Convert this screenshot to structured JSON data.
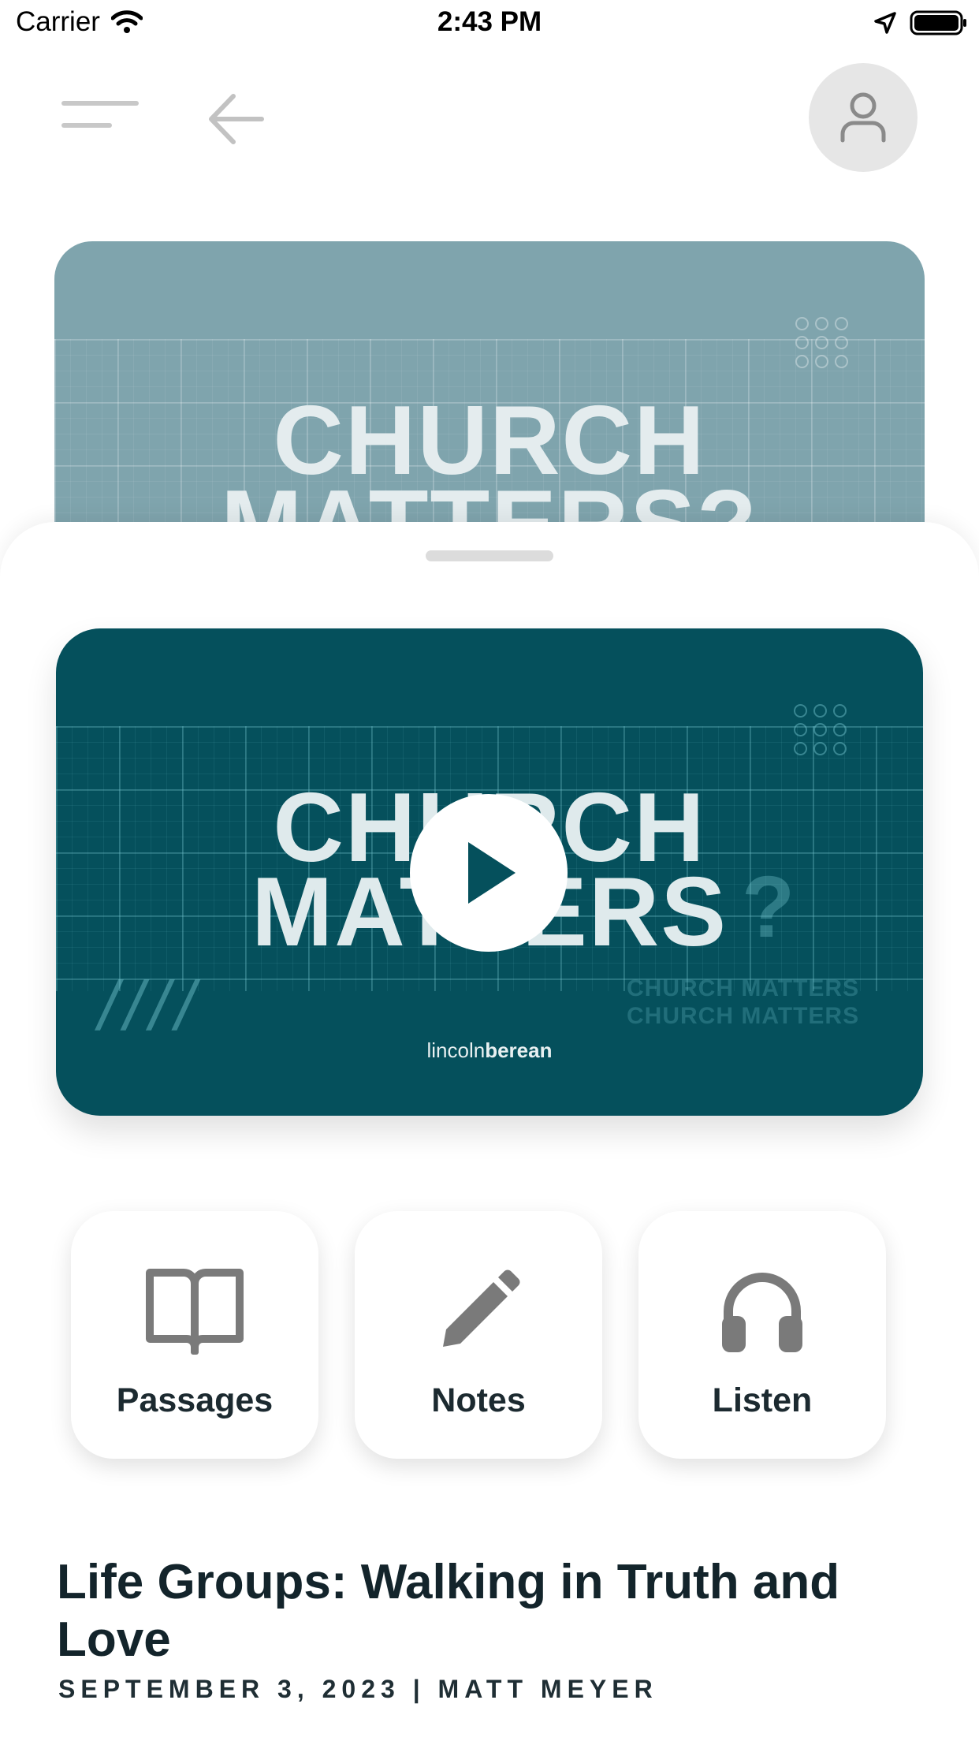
{
  "status_bar": {
    "carrier": "Carrier",
    "time": "2:43 PM"
  },
  "header": {
    "menu_icon": "menu-icon",
    "back_icon": "back-arrow-icon",
    "profile_icon": "person-icon"
  },
  "background_banner": {
    "title_line1": "CHURCH",
    "title_line2": "MATTERS?"
  },
  "video": {
    "title_line1": "CHURCH",
    "title_line2": "MATTERS",
    "question_mark": "?",
    "ghost_line1": "CHURCH MATTERS",
    "ghost_line2": "CHURCH MATTERS",
    "brand_light": "lincoln",
    "brand_bold": "berean",
    "play_icon": "play-icon"
  },
  "actions": [
    {
      "label": "Passages",
      "icon": "open-book-icon"
    },
    {
      "label": "Notes",
      "icon": "pencil-icon"
    },
    {
      "label": "Listen",
      "icon": "headphones-icon"
    }
  ],
  "sermon": {
    "title": "Life Groups: Walking in Truth and Love",
    "meta": "SEPTEMBER 3, 2023 | MATT MEYER"
  },
  "colors": {
    "video_bg": "#05505c",
    "banner_bg": "#7fa4ad",
    "icon_gray": "#7a7a7a"
  }
}
